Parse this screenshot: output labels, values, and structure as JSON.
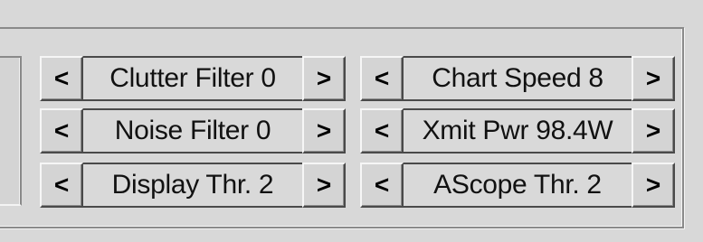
{
  "controls": [
    {
      "label": "Clutter Filter 0",
      "prev": "<",
      "next": ">"
    },
    {
      "label": "Chart Speed 8",
      "prev": "<",
      "next": ">"
    },
    {
      "label": "Noise Filter 0",
      "prev": "<",
      "next": ">"
    },
    {
      "label": "Xmit Pwr 98.4W",
      "prev": "<",
      "next": ">"
    },
    {
      "label": "Display Thr. 2",
      "prev": "<",
      "next": ">"
    },
    {
      "label": "AScope Thr. 2",
      "prev": "<",
      "next": ">"
    }
  ]
}
